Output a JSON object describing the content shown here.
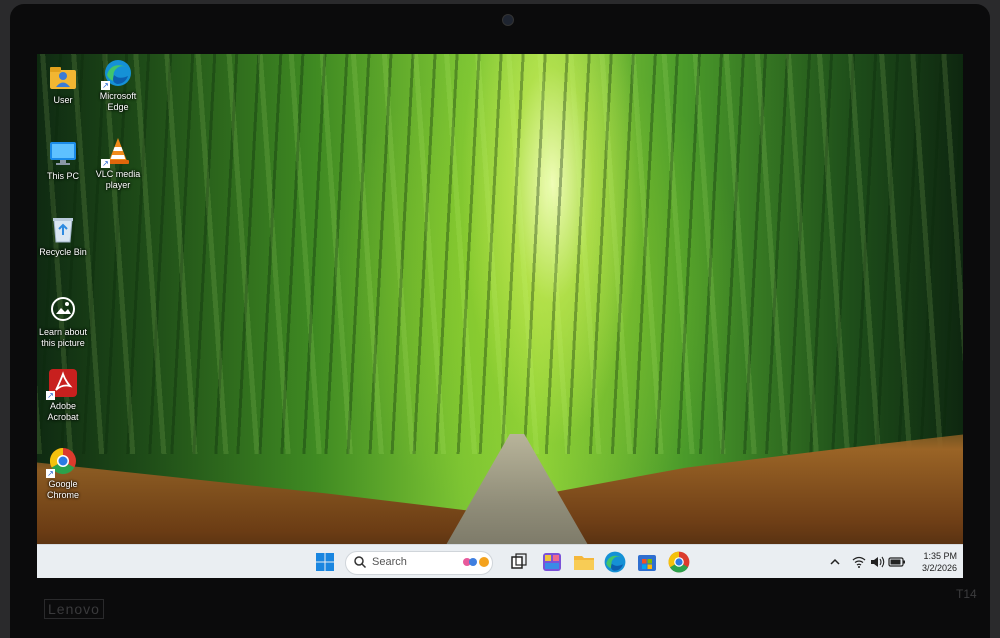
{
  "desktop": {
    "icons": [
      {
        "label": "User",
        "icon": "user-folder-icon"
      },
      {
        "label": "Microsoft Edge",
        "icon": "edge-icon"
      },
      {
        "label": "This PC",
        "icon": "monitor-icon"
      },
      {
        "label": "VLC media player",
        "icon": "vlc-cone-icon"
      },
      {
        "label": "Recycle Bin",
        "icon": "recycle-bin-icon"
      },
      {
        "label": "Learn about this picture",
        "icon": "camera-info-icon"
      },
      {
        "label": "Adobe Acrobat",
        "icon": "acrobat-icon"
      },
      {
        "label": "Google Chrome",
        "icon": "chrome-icon"
      }
    ]
  },
  "taskbar": {
    "search_placeholder": "Search",
    "pinned": [
      "start-icon",
      "widgets-icon",
      "task-view-icon",
      "copilot-icon",
      "file-explorer-icon",
      "edge-icon",
      "store-icon",
      "chrome-icon"
    ],
    "tray": {
      "time": "1:35 PM",
      "date": "3/2/2026"
    }
  },
  "device": {
    "brand": "Lenovo",
    "model": "T14"
  },
  "colors": {
    "taskbar_bg": "#eaeef2",
    "accent_blue": "#0078d4",
    "bezel": "#0b0b0c"
  }
}
